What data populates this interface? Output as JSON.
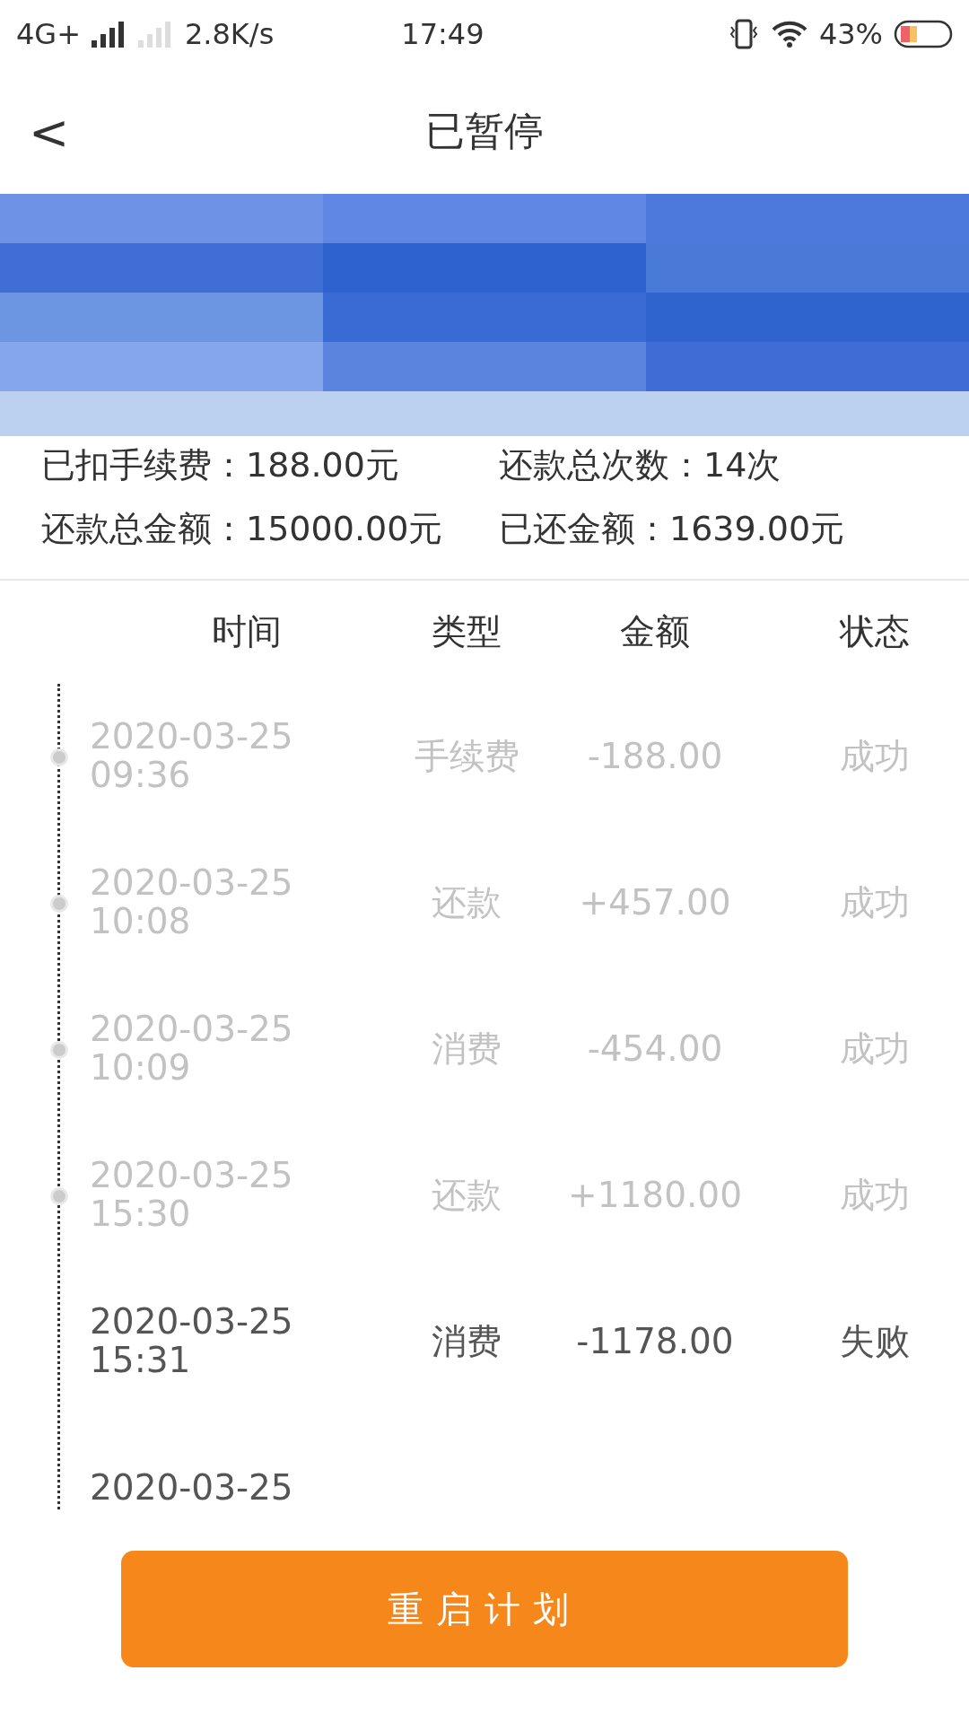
{
  "status_bar": {
    "network": "4G+",
    "speed": "2.8K/s",
    "time": "17:49",
    "battery": "43%"
  },
  "header": {
    "back": "<",
    "title": "已暂停"
  },
  "info": [
    {
      "label": "已扣手续费：",
      "value": "188.00元"
    },
    {
      "label": "还款总次数：",
      "value": "14次"
    },
    {
      "label": "还款总金额：",
      "value": "15000.00元"
    },
    {
      "label": "已还金额：",
      "value": "1639.00元"
    }
  ],
  "table": {
    "columns": [
      "时间",
      "类型",
      "金额",
      "状态"
    ],
    "rows": [
      {
        "date": "2020-03-25",
        "time": "09:36",
        "type": "手续费",
        "amount": "-188.00",
        "status": "成功",
        "dimmed": true
      },
      {
        "date": "2020-03-25",
        "time": "10:08",
        "type": "还款",
        "amount": "+457.00",
        "status": "成功",
        "dimmed": true
      },
      {
        "date": "2020-03-25",
        "time": "10:09",
        "type": "消费",
        "amount": "-454.00",
        "status": "成功",
        "dimmed": true
      },
      {
        "date": "2020-03-25",
        "time": "15:30",
        "type": "还款",
        "amount": "+1180.00",
        "status": "成功",
        "dimmed": true
      },
      {
        "date": "2020-03-25",
        "time": "15:31",
        "type": "消费",
        "amount": "-1178.00",
        "status": "失败",
        "dimmed": false
      },
      {
        "date": "2020-03-25",
        "dimmed": false
      }
    ]
  },
  "button": "重启计划"
}
